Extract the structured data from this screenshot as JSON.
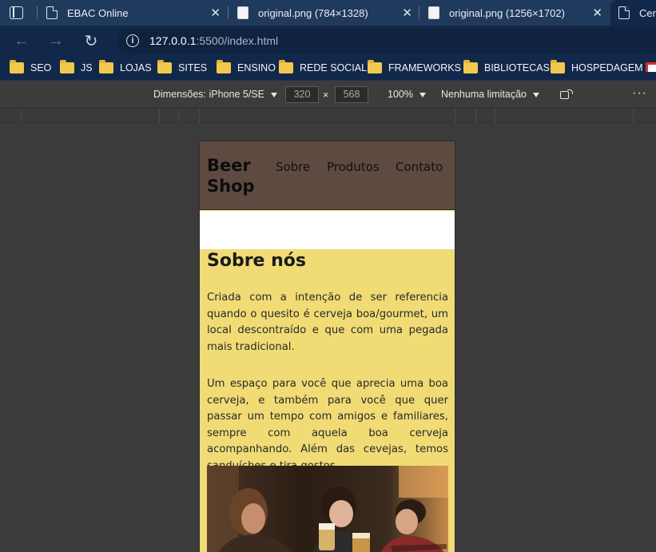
{
  "browser": {
    "tabs": [
      {
        "title": "EBAC Online",
        "icon": "page-icon"
      },
      {
        "title": "original.png (784×1328)",
        "icon": "image-icon"
      },
      {
        "title": "original.png (1256×1702)",
        "icon": "image-icon"
      },
      {
        "title": "Cerv",
        "icon": "page-icon"
      }
    ],
    "close_glyph": "✕",
    "url_host": "127.0.0.1",
    "url_rest": ":5500/index.html",
    "bookmarks": [
      "SEO",
      "JS",
      "LOJAS",
      "SITES",
      "ENSINO",
      "REDE SOCIAL",
      "FRAMEWORKS",
      "BIBLIOTECAS",
      "HOSPEDAGEM"
    ]
  },
  "devtools": {
    "device": "Dimensões: iPhone 5/SE",
    "width": "320",
    "times": "×",
    "height": "568",
    "zoom": "100%",
    "throttle": "Nenhuma limitação",
    "more": "⋮"
  },
  "site": {
    "brand": "Beer Shop",
    "nav": [
      "Sobre",
      "Produtos",
      "Contato"
    ],
    "about_title": "Sobre nós",
    "paragraph1": "Criada com a intenção de ser referencia quando o quesito é cerveja boa/gourmet, um local descontraído e que com uma pegada mais tradicional.",
    "paragraph2": "Um espaço para você que aprecia uma boa cerveja, e também para você que quer passar um tempo com amigos e familiares, sempre com aquela boa cerveja acompanhando. Além das cevejas, temos sanduíches e tira gostos."
  },
  "colors": {
    "header_bg": "#5e4a40",
    "content_bg": "#f0db75",
    "tabbar_bg": "#1f3a5c"
  }
}
